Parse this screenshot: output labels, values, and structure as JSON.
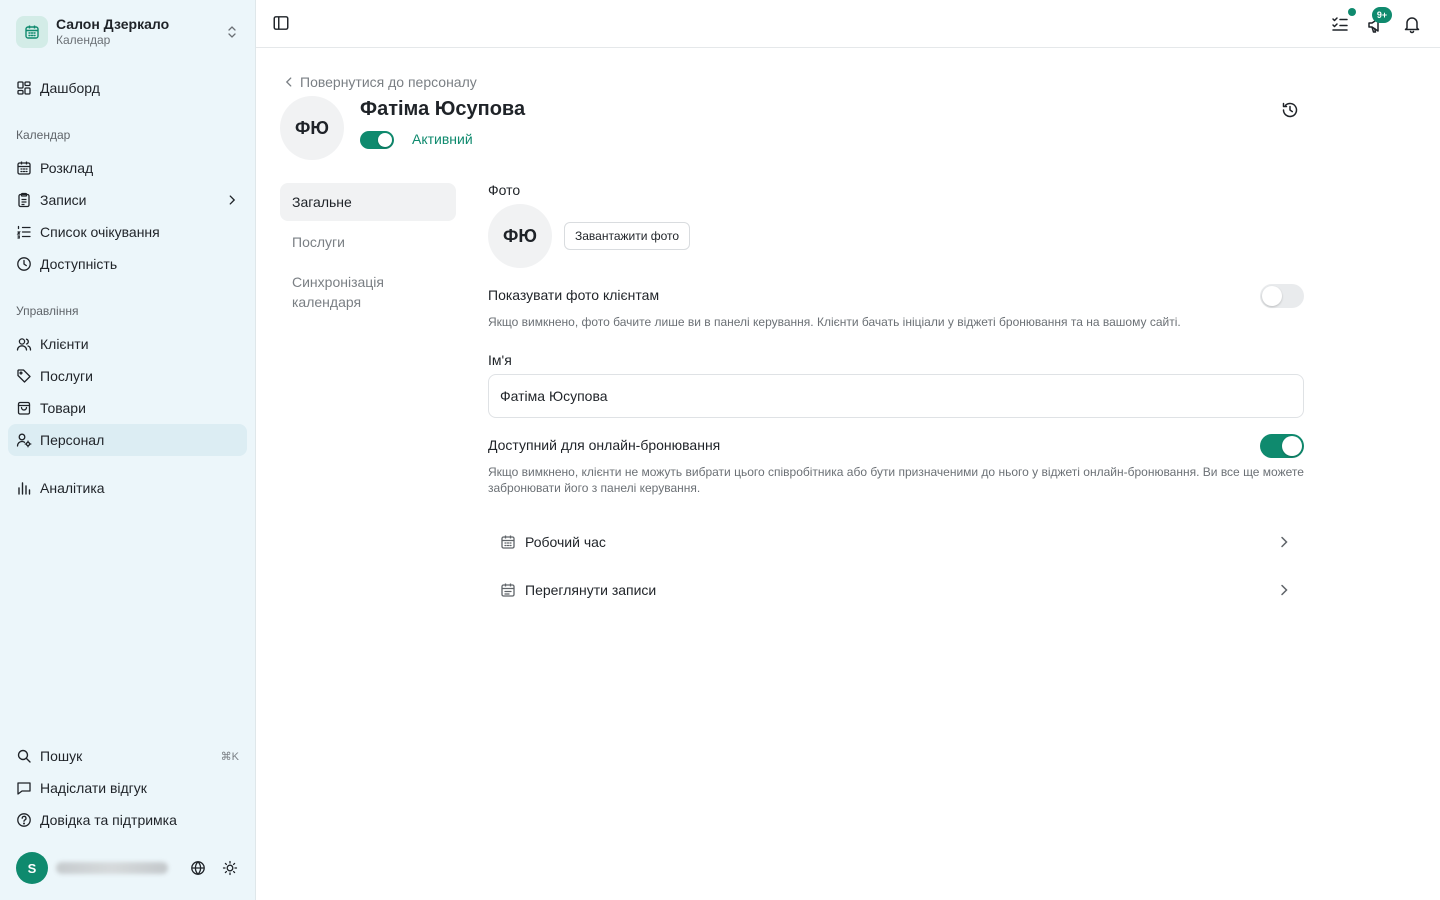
{
  "sidebar": {
    "org": {
      "name": "Салон Дзеркало",
      "subtitle": "Календар",
      "icon": "calendar-icon"
    },
    "dashboard": "Дашборд",
    "calendar_section": "Календар",
    "calendar_items": [
      {
        "label": "Розклад",
        "icon": "calendar-grid-icon"
      },
      {
        "label": "Записи",
        "icon": "clipboard-icon"
      },
      {
        "label": "Список очікування",
        "icon": "list-ordered-icon"
      },
      {
        "label": "Доступність",
        "icon": "clock-icon"
      }
    ],
    "manage_section": "Управління",
    "manage_items": [
      {
        "label": "Клієнти",
        "icon": "users-icon"
      },
      {
        "label": "Послуги",
        "icon": "tag-icon"
      },
      {
        "label": "Товари",
        "icon": "shopping-bag-icon"
      },
      {
        "label": "Персонал",
        "icon": "user-cog-icon",
        "active": true
      }
    ],
    "analytics": "Аналітика",
    "bottom": {
      "search": "Пошук",
      "search_shortcut": "⌘K",
      "feedback": "Надіслати відгук",
      "help": "Довідка та підтримка"
    },
    "user": {
      "initial": "S"
    }
  },
  "topbar": {
    "notifications_badge": "9+"
  },
  "page": {
    "back_link": "Повернутися до персоналу",
    "avatar_initials": "ФЮ",
    "staff_name": "Фатіма Юсупова",
    "status": {
      "label": "Активний",
      "on": true
    }
  },
  "subnav": [
    {
      "label": "Загальне",
      "active": true
    },
    {
      "label": "Послуги"
    },
    {
      "label": "Синхронізація календаря"
    }
  ],
  "form": {
    "photo_label": "Фото",
    "photo_initials": "ФЮ",
    "upload_button": "Завантажити фото",
    "show_photo": {
      "label": "Показувати фото клієнтам",
      "help": "Якщо вимкнено, фото бачите лише ви в панелі керування. Клієнти бачать ініціали у віджеті бронювання та на вашому сайті.",
      "on": false
    },
    "name": {
      "label": "Ім'я",
      "value": "Фатіма Юсупова"
    },
    "online_booking": {
      "label": "Доступний для онлайн-бронювання",
      "help": "Якщо вимкнено, клієнти не можуть вибрати цього співробітника або бути призначеними до нього у віджеті онлайн-бронювання. Ви все ще можете забронювати його з панелі керування.",
      "on": true
    },
    "links": [
      {
        "label": "Робочий час",
        "icon": "calendar-icon"
      },
      {
        "label": "Переглянути записи",
        "icon": "calendar-list-icon"
      }
    ]
  },
  "colors": {
    "accent": "#0f8a6e",
    "sidebar_bg": "#ecf6fa"
  }
}
